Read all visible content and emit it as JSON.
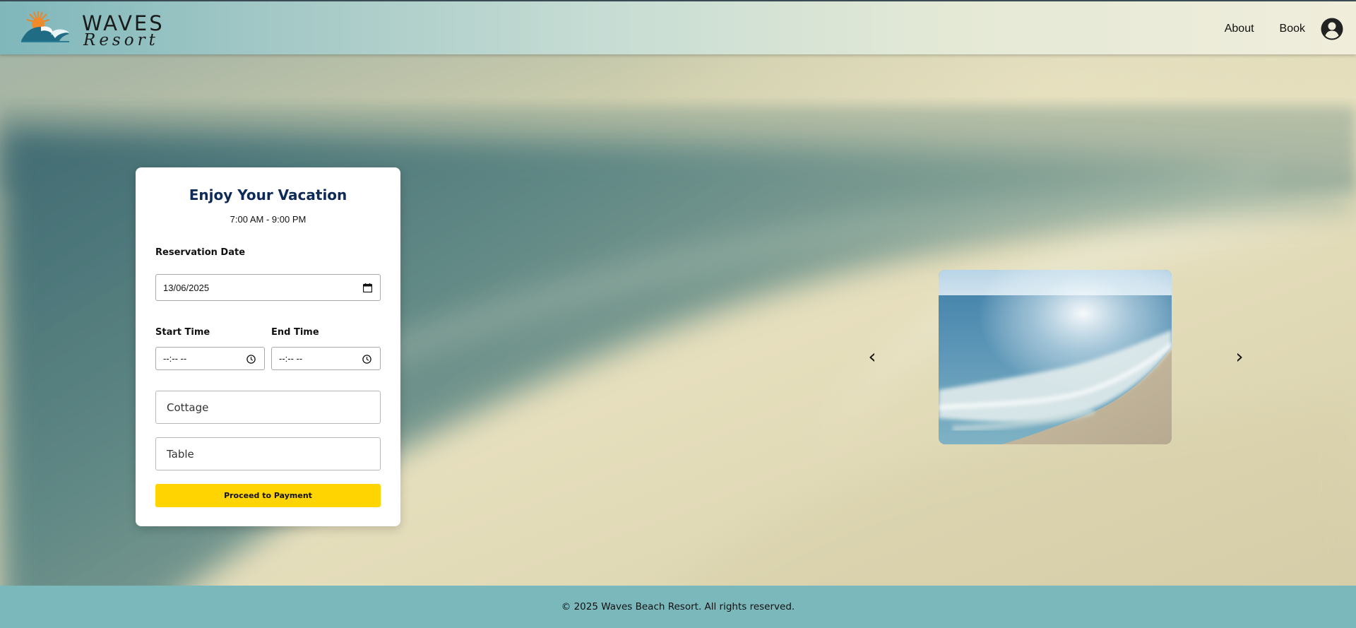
{
  "brand": {
    "name": "WAVES",
    "tagline": "Resort"
  },
  "nav": {
    "about_label": "About",
    "book_label": "Book",
    "user_icon": "user-circle-icon"
  },
  "booking": {
    "title": "Enjoy Your Vacation",
    "hours": "7:00 AM - 9:00 PM",
    "date_label": "Reservation Date",
    "date_value": "13/06/2025",
    "start_label": "Start Time",
    "start_value": "--:-- --",
    "end_label": "End Time",
    "end_value": "--:-- --",
    "cottage_placeholder": "Cottage",
    "table_placeholder": "Table",
    "submit_label": "Proceed to Payment"
  },
  "carousel": {
    "prev_label": "‹",
    "next_label": "›"
  },
  "footer": {
    "text": "© 2025 Waves Beach Resort. All rights reserved."
  },
  "colors": {
    "header_start": "#7fb7bb",
    "footer": "#7ab8bb",
    "title": "#0e2a57",
    "button": "#ffd400"
  }
}
